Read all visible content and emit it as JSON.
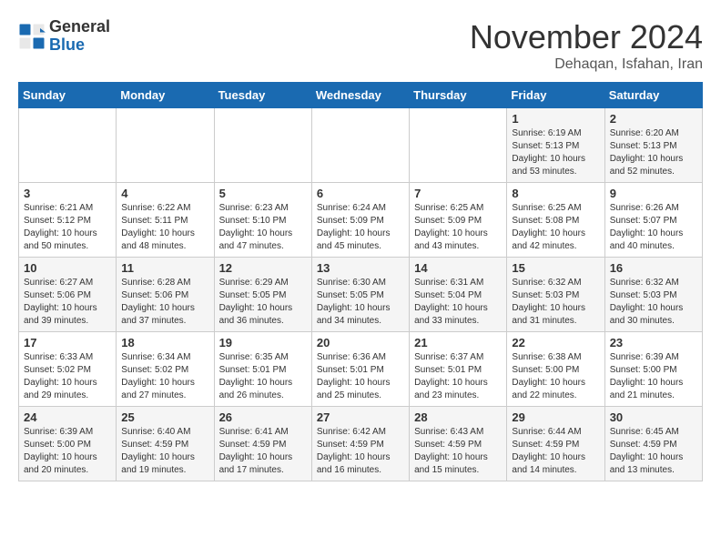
{
  "header": {
    "logo": {
      "general": "General",
      "blue": "Blue"
    },
    "month": "November 2024",
    "location": "Dehaqan, Isfahan, Iran"
  },
  "weekdays": [
    "Sunday",
    "Monday",
    "Tuesday",
    "Wednesday",
    "Thursday",
    "Friday",
    "Saturday"
  ],
  "weeks": [
    [
      {
        "day": "",
        "info": ""
      },
      {
        "day": "",
        "info": ""
      },
      {
        "day": "",
        "info": ""
      },
      {
        "day": "",
        "info": ""
      },
      {
        "day": "",
        "info": ""
      },
      {
        "day": "1",
        "info": "Sunrise: 6:19 AM\nSunset: 5:13 PM\nDaylight: 10 hours\nand 53 minutes."
      },
      {
        "day": "2",
        "info": "Sunrise: 6:20 AM\nSunset: 5:13 PM\nDaylight: 10 hours\nand 52 minutes."
      }
    ],
    [
      {
        "day": "3",
        "info": "Sunrise: 6:21 AM\nSunset: 5:12 PM\nDaylight: 10 hours\nand 50 minutes."
      },
      {
        "day": "4",
        "info": "Sunrise: 6:22 AM\nSunset: 5:11 PM\nDaylight: 10 hours\nand 48 minutes."
      },
      {
        "day": "5",
        "info": "Sunrise: 6:23 AM\nSunset: 5:10 PM\nDaylight: 10 hours\nand 47 minutes."
      },
      {
        "day": "6",
        "info": "Sunrise: 6:24 AM\nSunset: 5:09 PM\nDaylight: 10 hours\nand 45 minutes."
      },
      {
        "day": "7",
        "info": "Sunrise: 6:25 AM\nSunset: 5:09 PM\nDaylight: 10 hours\nand 43 minutes."
      },
      {
        "day": "8",
        "info": "Sunrise: 6:25 AM\nSunset: 5:08 PM\nDaylight: 10 hours\nand 42 minutes."
      },
      {
        "day": "9",
        "info": "Sunrise: 6:26 AM\nSunset: 5:07 PM\nDaylight: 10 hours\nand 40 minutes."
      }
    ],
    [
      {
        "day": "10",
        "info": "Sunrise: 6:27 AM\nSunset: 5:06 PM\nDaylight: 10 hours\nand 39 minutes."
      },
      {
        "day": "11",
        "info": "Sunrise: 6:28 AM\nSunset: 5:06 PM\nDaylight: 10 hours\nand 37 minutes."
      },
      {
        "day": "12",
        "info": "Sunrise: 6:29 AM\nSunset: 5:05 PM\nDaylight: 10 hours\nand 36 minutes."
      },
      {
        "day": "13",
        "info": "Sunrise: 6:30 AM\nSunset: 5:05 PM\nDaylight: 10 hours\nand 34 minutes."
      },
      {
        "day": "14",
        "info": "Sunrise: 6:31 AM\nSunset: 5:04 PM\nDaylight: 10 hours\nand 33 minutes."
      },
      {
        "day": "15",
        "info": "Sunrise: 6:32 AM\nSunset: 5:03 PM\nDaylight: 10 hours\nand 31 minutes."
      },
      {
        "day": "16",
        "info": "Sunrise: 6:32 AM\nSunset: 5:03 PM\nDaylight: 10 hours\nand 30 minutes."
      }
    ],
    [
      {
        "day": "17",
        "info": "Sunrise: 6:33 AM\nSunset: 5:02 PM\nDaylight: 10 hours\nand 29 minutes."
      },
      {
        "day": "18",
        "info": "Sunrise: 6:34 AM\nSunset: 5:02 PM\nDaylight: 10 hours\nand 27 minutes."
      },
      {
        "day": "19",
        "info": "Sunrise: 6:35 AM\nSunset: 5:01 PM\nDaylight: 10 hours\nand 26 minutes."
      },
      {
        "day": "20",
        "info": "Sunrise: 6:36 AM\nSunset: 5:01 PM\nDaylight: 10 hours\nand 25 minutes."
      },
      {
        "day": "21",
        "info": "Sunrise: 6:37 AM\nSunset: 5:01 PM\nDaylight: 10 hours\nand 23 minutes."
      },
      {
        "day": "22",
        "info": "Sunrise: 6:38 AM\nSunset: 5:00 PM\nDaylight: 10 hours\nand 22 minutes."
      },
      {
        "day": "23",
        "info": "Sunrise: 6:39 AM\nSunset: 5:00 PM\nDaylight: 10 hours\nand 21 minutes."
      }
    ],
    [
      {
        "day": "24",
        "info": "Sunrise: 6:39 AM\nSunset: 5:00 PM\nDaylight: 10 hours\nand 20 minutes."
      },
      {
        "day": "25",
        "info": "Sunrise: 6:40 AM\nSunset: 4:59 PM\nDaylight: 10 hours\nand 19 minutes."
      },
      {
        "day": "26",
        "info": "Sunrise: 6:41 AM\nSunset: 4:59 PM\nDaylight: 10 hours\nand 17 minutes."
      },
      {
        "day": "27",
        "info": "Sunrise: 6:42 AM\nSunset: 4:59 PM\nDaylight: 10 hours\nand 16 minutes."
      },
      {
        "day": "28",
        "info": "Sunrise: 6:43 AM\nSunset: 4:59 PM\nDaylight: 10 hours\nand 15 minutes."
      },
      {
        "day": "29",
        "info": "Sunrise: 6:44 AM\nSunset: 4:59 PM\nDaylight: 10 hours\nand 14 minutes."
      },
      {
        "day": "30",
        "info": "Sunrise: 6:45 AM\nSunset: 4:59 PM\nDaylight: 10 hours\nand 13 minutes."
      }
    ]
  ]
}
